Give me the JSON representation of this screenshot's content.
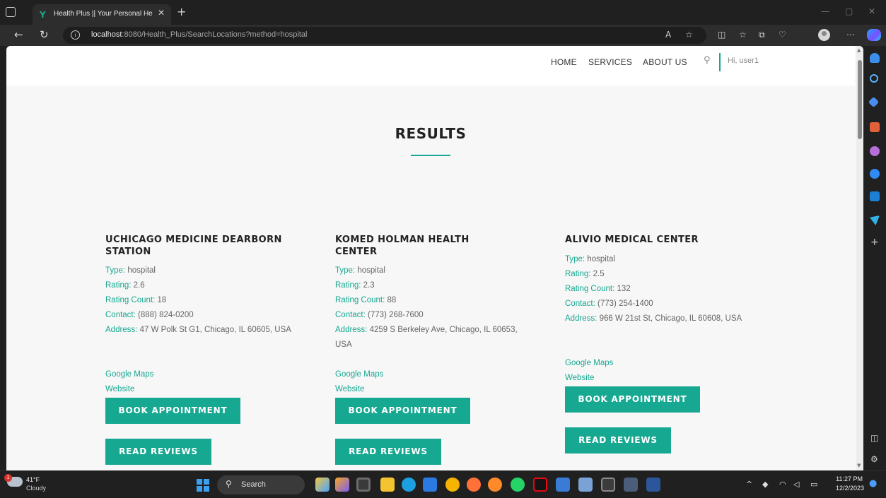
{
  "browser": {
    "tab_title": "Health Plus || Your Personal Health Assistant",
    "tab_favicon": "Y",
    "url_host": "localhost",
    "url_rest": ":8080/Health_Plus/SearchLocations?method=hospital"
  },
  "header": {
    "nav": [
      "HOME",
      "SERVICES",
      "ABOUT US"
    ],
    "greeting": "Hi, user1"
  },
  "main": {
    "title": "RESULTS",
    "cards": [
      {
        "name": "UCHICAGO MEDICINE DEARBORN STATION",
        "type_label": "Type:",
        "type": "hospital",
        "rating_label": "Rating:",
        "rating": "2.6",
        "count_label": "Rating Count:",
        "count": "18",
        "contact_label": "Contact:",
        "contact": "(888) 824-0200",
        "address_label": "Address:",
        "address": "47 W Polk St G1, Chicago, IL 60605, USA",
        "maps": "Google Maps",
        "website": "Website",
        "book": "BOOK APPOINTMENT",
        "reviews": "READ REVIEWS"
      },
      {
        "name": "KOMED HOLMAN HEALTH CENTER",
        "type_label": "Type:",
        "type": "hospital",
        "rating_label": "Rating:",
        "rating": "2.3",
        "count_label": "Rating Count:",
        "count": "88",
        "contact_label": "Contact:",
        "contact": "(773) 268-7600",
        "address_label": "Address:",
        "address": "4259 S Berkeley Ave, Chicago, IL 60653, USA",
        "maps": "Google Maps",
        "website": "Website",
        "book": "BOOK APPOINTMENT",
        "reviews": "READ REVIEWS"
      },
      {
        "name": "ALIVIO MEDICAL CENTER",
        "type_label": "Type:",
        "type": "hospital",
        "rating_label": "Rating:",
        "rating": "2.5",
        "count_label": "Rating Count:",
        "count": "132",
        "contact_label": "Contact:",
        "contact": "(773) 254-1400",
        "address_label": "Address:",
        "address": "966 W 21st St, Chicago, IL 60608, USA",
        "maps": "Google Maps",
        "website": "Website",
        "book": "BOOK APPOINTMENT",
        "reviews": "READ REVIEWS"
      }
    ]
  },
  "taskbar": {
    "weather_temp": "41°F",
    "weather_cond": "Cloudy",
    "weather_badge": "1",
    "search_label": "Search",
    "time": "11:27 PM",
    "date": "12/2/2023"
  },
  "colors": {
    "accent": "#16a891",
    "page_bg": "#f7f7f7",
    "chrome_bg": "#202020"
  }
}
